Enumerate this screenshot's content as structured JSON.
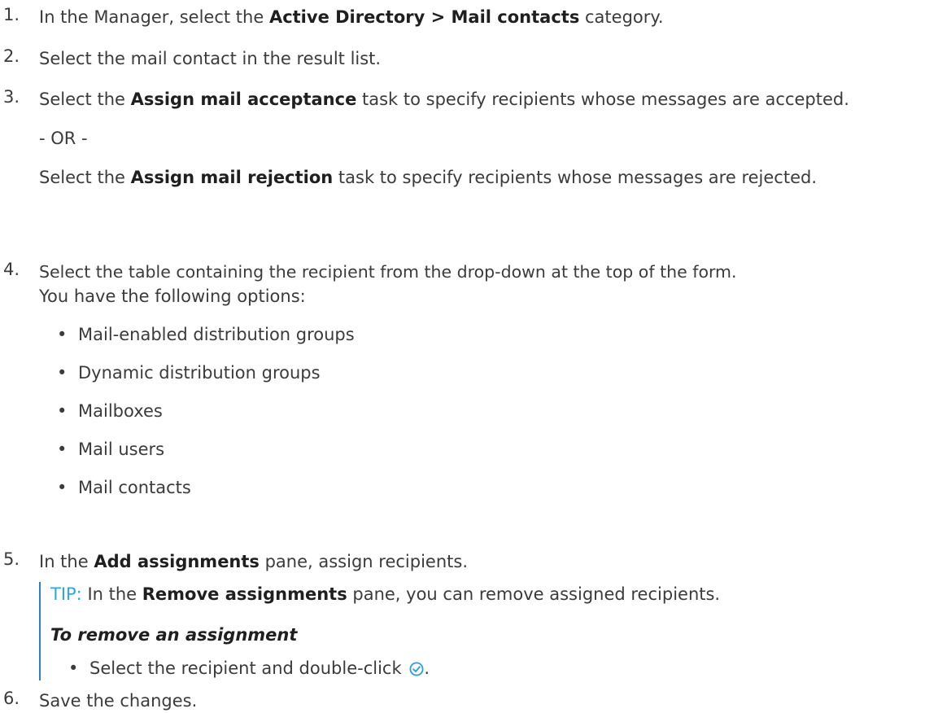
{
  "steps": [
    {
      "number": "1.",
      "pre": "In the Manager, select the ",
      "bold": "Active Directory > Mail contacts",
      "post": " category."
    },
    {
      "number": "2.",
      "text": "Select the mail contact in the result list."
    },
    {
      "number": "3.",
      "acceptance": {
        "pre": "Select the ",
        "bold": "Assign mail acceptance",
        "post": " task to specify recipients whose messages are accepted."
      },
      "or": "- OR -",
      "rejection": {
        "pre": "Select the ",
        "bold": "Assign mail rejection",
        "post": " task to specify recipients whose messages are rejected."
      }
    },
    {
      "number": "4.",
      "line1": "Select the table containing the recipient from the drop-down at the top of the form.",
      "line2": "You have the following options:",
      "options": [
        "Mail-enabled distribution groups",
        "Dynamic distribution groups",
        "Mailboxes",
        "Mail users",
        "Mail contacts"
      ]
    },
    {
      "number": "5.",
      "pre": "In the ",
      "bold": "Add assignments",
      "post": " pane, assign recipients.",
      "tip": {
        "label": "TIP:",
        "pre": " In the ",
        "bold": "Remove assignments",
        "post": " pane, you can remove assigned recipients.",
        "heading": "To remove an assignment",
        "bullet": "Select the recipient and double-click",
        "bullet_end": "."
      }
    },
    {
      "number": "6.",
      "text": "Save the changes."
    }
  ],
  "bullet_char": "•",
  "colors": {
    "text": "#3b3b3b",
    "bold": "#1f1f1f",
    "tip_label": "#29a8e0",
    "tip_border": "#2f7fc1",
    "check_icon": "#2b9de0"
  },
  "icons": {
    "inline_check": "check-circle-icon"
  }
}
